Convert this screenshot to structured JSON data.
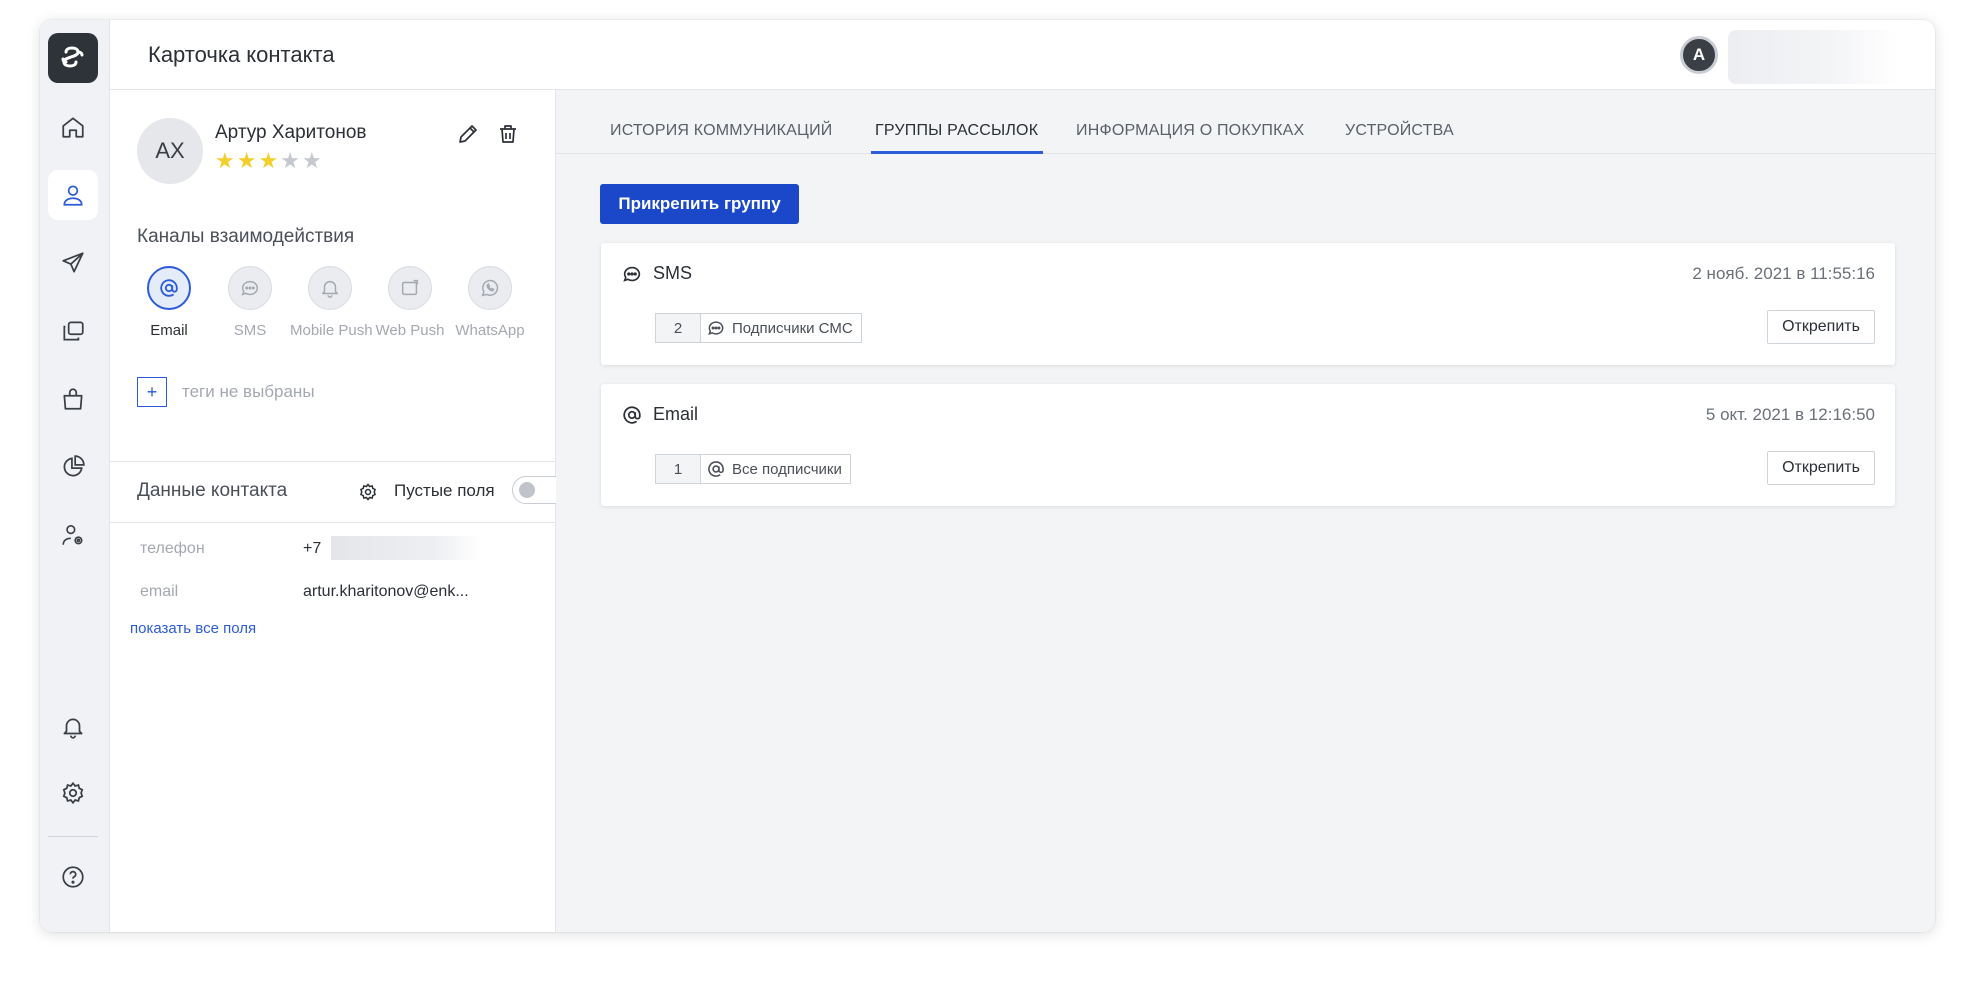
{
  "header": {
    "title": "Карточка контакта",
    "user_initial": "A"
  },
  "sidebar": {
    "logo_icon": "brand-logo-icon",
    "items": [
      {
        "icon": "home-icon",
        "active": false
      },
      {
        "icon": "contact-icon",
        "active": true
      },
      {
        "icon": "send-icon",
        "active": false
      },
      {
        "icon": "copy-icon",
        "active": false
      },
      {
        "icon": "shopping-bag-icon",
        "active": false
      },
      {
        "icon": "pie-chart-icon",
        "active": false
      },
      {
        "icon": "user-settings-icon",
        "active": false
      },
      {
        "icon": "bell-icon",
        "active": false
      },
      {
        "icon": "gear-icon",
        "active": false
      },
      {
        "icon": "help-icon",
        "active": false
      }
    ]
  },
  "contact": {
    "initials": "АХ",
    "name": "Артур Харитонов",
    "rating": 3,
    "rating_max": 5,
    "channels_title": "Каналы взаимодействия",
    "channels": [
      {
        "label": "Email",
        "icon": "at-icon",
        "active": true
      },
      {
        "label": "SMS",
        "icon": "chat-icon",
        "active": false
      },
      {
        "label": "Mobile Push",
        "icon": "bell-icon",
        "active": false
      },
      {
        "label": "Web Push",
        "icon": "browser-icon",
        "active": false
      },
      {
        "label": "WhatsApp",
        "icon": "whatsapp-icon",
        "active": false
      }
    ],
    "tags_add": "+",
    "tags_empty": "теги не выбраны",
    "data_title": "Данные контакта",
    "empty_fields_label": "Пустые поля",
    "empty_fields_on": false,
    "fields": [
      {
        "key": "телефон",
        "value": "+7"
      },
      {
        "key": "email",
        "value": "artur.kharitonov@enk..."
      }
    ],
    "show_all": "показать все поля"
  },
  "tabs": [
    {
      "label": "ИСТОРИЯ КОММУНИКАЦИЙ",
      "active": false
    },
    {
      "label": "ГРУППЫ РАССЫЛОК",
      "active": true
    },
    {
      "label": "ИНФОРМАЦИЯ О ПОКУПКАХ",
      "active": false
    },
    {
      "label": "УСТРОЙСТВА",
      "active": false
    }
  ],
  "attach_button": "Прикрепить группу",
  "groups": [
    {
      "channel": "SMS",
      "icon": "chat-icon",
      "date": "2 нояб. 2021 в 11:55:16",
      "count": "2",
      "group_name": "Подписчики СМС",
      "detach": "Открепить"
    },
    {
      "channel": "Email",
      "icon": "at-icon",
      "date": "5 окт. 2021 в 12:16:50",
      "count": "1",
      "group_name": "Все подписчики",
      "detach": "Открепить"
    }
  ],
  "colors": {
    "accent": "#2c5bd8",
    "primary_button": "#1b47c9",
    "star": "#f2cf2c",
    "rail_bg": "#f1f2f5",
    "main_bg": "#f3f4f6"
  }
}
